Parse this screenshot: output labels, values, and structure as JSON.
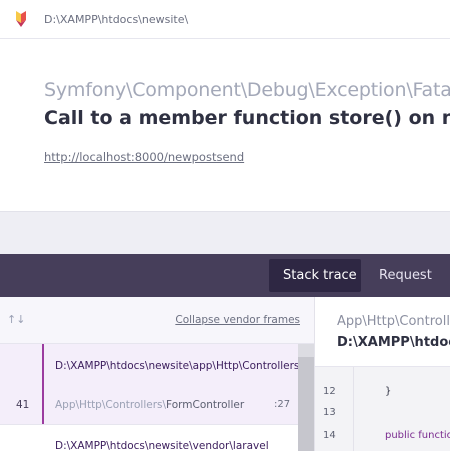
{
  "topbar": {
    "path": "D:\\XAMPP\\htdocs\\newsite\\"
  },
  "exception": {
    "class": "Symfony\\Component\\Debug\\Exception\\FatalThrowableError",
    "message": "Call to a member function store() on null",
    "url": "http://localhost:8000/newpostsend"
  },
  "tabs": {
    "stack_trace": "Stack trace",
    "request": "Request"
  },
  "frames_pane": {
    "arrows": "↑↓",
    "collapse_label": "Collapse vendor frames",
    "frames": [
      {
        "number": "41",
        "file": "D:\\XAMPP\\htdocs\\newsite\\app\\Http\\Controllers\\FormController.php",
        "class_prefix": "App\\Http\\Controllers\\",
        "class_name": "FormController",
        "line": ":27"
      },
      {
        "file": "D:\\XAMPP\\htdocs\\newsite\\vendor\\laravel"
      }
    ]
  },
  "code_pane": {
    "class": "App\\Http\\Controllers\\FormController",
    "path": "D:\\XAMPP\\htdocs\\newsite\\app\\Http\\Controllers\\FormController.php",
    "lines": [
      {
        "n": "12",
        "text": "}"
      },
      {
        "n": "13",
        "text": ""
      },
      {
        "n": "14",
        "text": "public function"
      }
    ]
  }
}
